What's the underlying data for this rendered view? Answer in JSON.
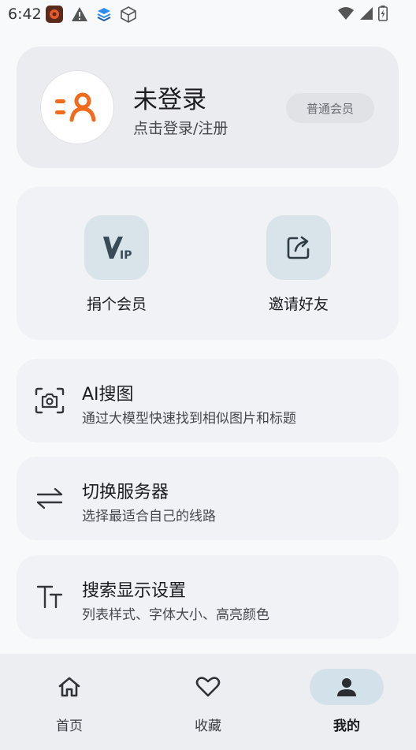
{
  "status_bar": {
    "time": "6:42",
    "left_icons": [
      "app-icon",
      "warning-icon",
      "layers-icon",
      "cube-icon"
    ],
    "right_icons": [
      "wifi-icon",
      "signal-icon",
      "battery-icon"
    ]
  },
  "profile": {
    "name": "未登录",
    "subtitle": "点击登录/注册",
    "badge": "普通会员",
    "accent_color": "#f26a1b"
  },
  "quick_actions": [
    {
      "label": "捐个会员",
      "icon": "vip-icon"
    },
    {
      "label": "邀请好友",
      "icon": "share-icon"
    }
  ],
  "settings": [
    {
      "title": "AI搜图",
      "subtitle": "通过大模型快速找到相似图片和标题",
      "icon": "camera-scan-icon"
    },
    {
      "title": "切换服务器",
      "subtitle": "选择最适合自己的线路",
      "icon": "swap-icon"
    },
    {
      "title": "搜索显示设置",
      "subtitle": "列表样式、字体大小、高亮颜色",
      "icon": "text-size-icon"
    }
  ],
  "bottom_nav": [
    {
      "label": "首页",
      "icon": "home-icon",
      "active": false
    },
    {
      "label": "收藏",
      "icon": "heart-icon",
      "active": false
    },
    {
      "label": "我的",
      "icon": "person-icon",
      "active": true
    }
  ]
}
